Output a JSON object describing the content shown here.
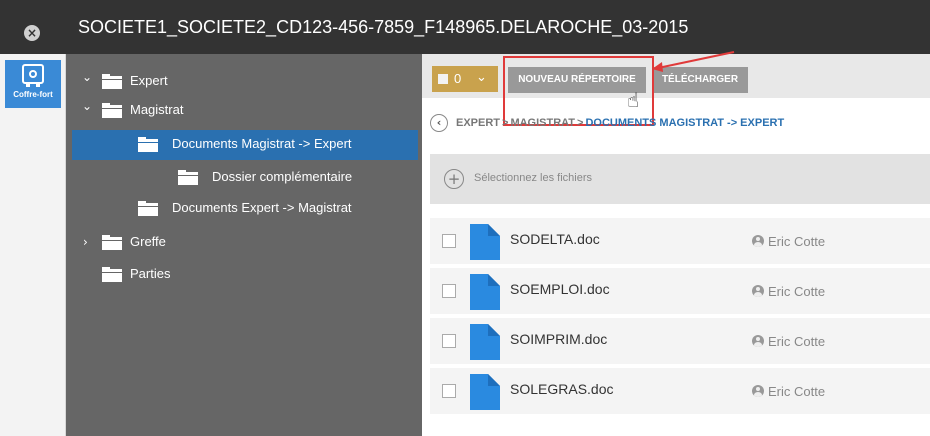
{
  "window": {
    "title": "SOCIETE1_SOCIETE2_CD123-456-7859_F148965.DELAROCHE_03-2015",
    "close_glyph": "×"
  },
  "rail": {
    "items": [
      {
        "label": "Coffre-fort",
        "icon": "safe-icon",
        "active": true
      }
    ]
  },
  "tree": {
    "items": [
      {
        "label": "Expert",
        "expanded": true,
        "chevron": "⌄"
      },
      {
        "label": "Magistrat",
        "expanded": true,
        "chevron": "⌄"
      },
      {
        "label": "Documents Magistrat -> Expert",
        "selected": true
      },
      {
        "label": "Dossier complémentaire"
      },
      {
        "label": "Documents Expert -> Magistrat"
      },
      {
        "label": "Greffe",
        "expanded": false,
        "chevron": "›"
      },
      {
        "label": "Parties"
      }
    ]
  },
  "toolbar": {
    "selection_count": "0",
    "dropdown_glyph": "⌄",
    "new_folder_label": "NOUVEAU RÉPERTOIRE",
    "download_label": "TÉLÉCHARGER"
  },
  "breadcrumb": {
    "back_glyph": "‹",
    "items": [
      "EXPERT",
      "MAGISTRAT",
      "DOCUMENTS MAGISTRAT -> EXPERT"
    ],
    "separator": ">"
  },
  "dropzone": {
    "plus_glyph": "+",
    "label": "Sélectionnez les fichiers"
  },
  "files": [
    {
      "name": "SODELTA.doc",
      "owner": "Eric Cotte"
    },
    {
      "name": "SOEMPLOI.doc",
      "owner": "Eric Cotte"
    },
    {
      "name": "SOIMPRIM.doc",
      "owner": "Eric Cotte"
    },
    {
      "name": "SOLEGRAS.doc",
      "owner": "Eric Cotte"
    }
  ],
  "colors": {
    "titlebar": "#333333",
    "tree_bg": "#666666",
    "selected": "#2a70b0",
    "rail_active": "#3a8ad6",
    "count_button": "#c9a24d",
    "toolbar_button": "#999999",
    "highlight": "#e03a3a",
    "doc_icon": "#2a8ae0"
  }
}
